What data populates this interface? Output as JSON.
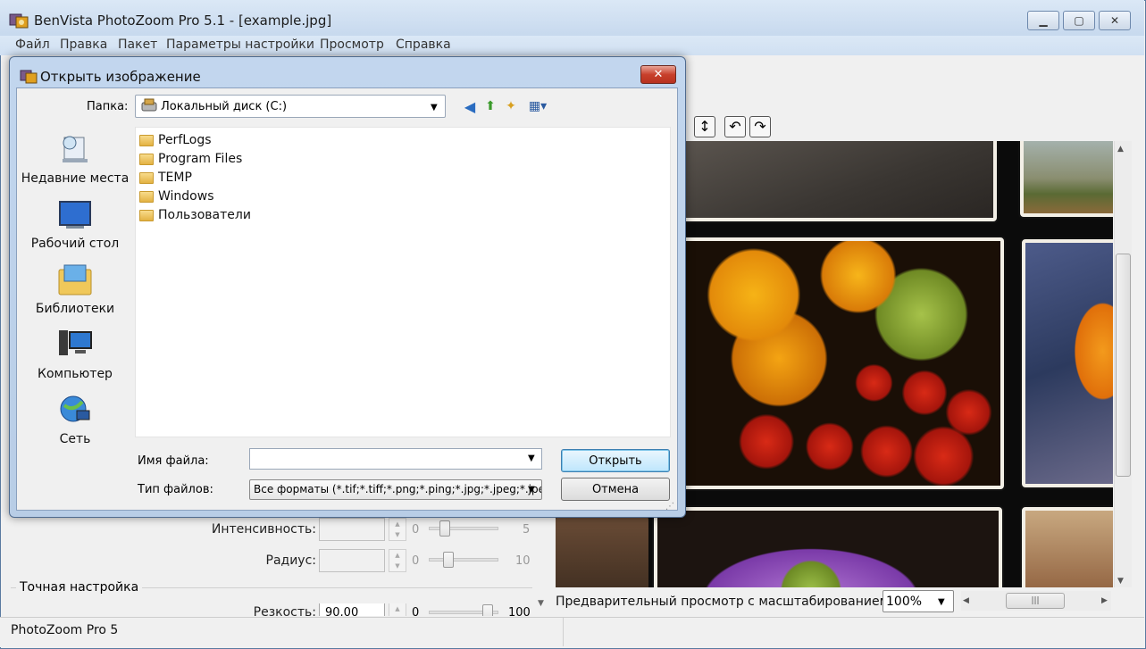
{
  "app": {
    "title": "BenVista PhotoZoom Pro 5.1 - [example.jpg]",
    "status": "PhotoZoom Pro 5"
  },
  "menu": [
    "Файл",
    "Правка",
    "Пакет",
    "Параметры настройки",
    "Просмотр",
    "Справка"
  ],
  "settings": {
    "intensity_label": "Интенсивность:",
    "intensity_min": "0",
    "intensity_max": "5",
    "radius_label": "Радиус:",
    "radius_min": "0",
    "radius_max": "10",
    "fine_tune_title": "Точная настройка",
    "sharpness_label": "Резкость:",
    "sharpness_value": "90,00",
    "sharpness_min": "0",
    "sharpness_max": "100"
  },
  "preview": {
    "label": "Предварительный просмотр с масштабированием:",
    "zoom": "100%"
  },
  "dialog": {
    "title": "Открыть изображение",
    "folder_label": "Папка:",
    "folder_value": "Локальный диск (C:)",
    "places": [
      "Недавние места",
      "Рабочий стол",
      "Библиотеки",
      "Компьютер",
      "Сеть"
    ],
    "files": [
      "PerfLogs",
      "Program Files",
      "TEMP",
      "Windows",
      "Пользователи"
    ],
    "filename_label": "Имя файла:",
    "filename_value": "",
    "filetype_label": "Тип файлов:",
    "filetype_value": "Все форматы (*.tif;*.tiff;*.png;*.ping;*.jpg;*.jpeg;*.jpe",
    "open_button": "Открыть",
    "cancel_button": "Отмена"
  },
  "colors": {
    "title_bar": "#c7d9ee",
    "close_red": "#c8402c",
    "primary_button": "#bee6fd"
  }
}
